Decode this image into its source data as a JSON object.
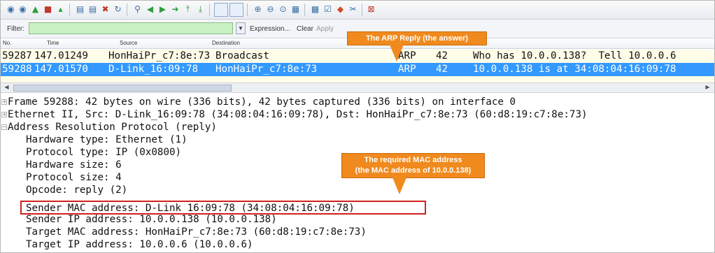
{
  "filter": {
    "label": "Filter:",
    "expression_label": "Expression...",
    "clear_label": "Clear",
    "apply_label": "Apply"
  },
  "columns": {
    "no": "No.",
    "time": "Time",
    "source": "Source",
    "destination": "Destination"
  },
  "packets": [
    {
      "no": "59287",
      "time": "147.01249",
      "source": "HonHaiPr_c7:8e:73",
      "destination": "Broadcast",
      "protocol": "ARP",
      "length": "42",
      "info": "Who has 10.0.0.138?  Tell 10.0.0.6"
    },
    {
      "no": "59288",
      "time": "147.01570",
      "source": "D-Link_16:09:78",
      "destination": "HonHaiPr_c7:8e:73",
      "protocol": "ARP",
      "length": "42",
      "info": "10.0.0.138 is at 34:08:04:16:09:78"
    }
  ],
  "details": {
    "frame": "Frame 59288: 42 bytes on wire (336 bits), 42 bytes captured (336 bits) on interface 0",
    "ethernet": "Ethernet II, Src: D-Link_16:09:78 (34:08:04:16:09:78), Dst: HonHaiPr_c7:8e:73 (60:d8:19:c7:8e:73)",
    "arp": "Address Resolution Protocol (reply)",
    "fields": [
      "Hardware type: Ethernet (1)",
      "Protocol type: IP (0x0800)",
      "Hardware size: 6",
      "Protocol size: 4",
      "Opcode: reply (2)",
      "Sender MAC address: D-Link_16:09:78 (34:08:04:16:09:78)",
      "Sender IP address: 10.0.0.138 (10.0.0.138)",
      "Target MAC address: HonHaiPr_c7:8e:73 (60:d8:19:c7:8e:73)",
      "Target IP address: 10.0.0.6 (10.0.0.6)"
    ]
  },
  "callouts": {
    "arp_reply": "The ARP Reply (the answer)",
    "mac_line1": "The required MAC address",
    "mac_line2": "(the MAC address of 10.0.0.138)"
  },
  "colors": {
    "selected_row": "#3399ff",
    "callout": "#f08a1e",
    "highlight_box": "#d41f1f",
    "filter_input": "#c9f2c3"
  },
  "toolbar_icons": [
    "interface-icon",
    "options-icon",
    "start-capture-icon",
    "stop-capture-icon",
    "restart-capture-icon",
    "open-file-icon",
    "save-file-icon",
    "close-file-icon",
    "reload-icon",
    "find-icon",
    "back-icon",
    "forward-icon",
    "goto-icon",
    "first-packet-icon",
    "last-packet-icon",
    "colorize-icon",
    "autoscroll-icon",
    "zoom-in-icon",
    "zoom-out-icon",
    "normal-size-icon",
    "resize-columns-icon",
    "capture-filters-icon",
    "display-filters-icon",
    "coloring-rules-icon",
    "preferences-icon",
    "help-icon"
  ]
}
